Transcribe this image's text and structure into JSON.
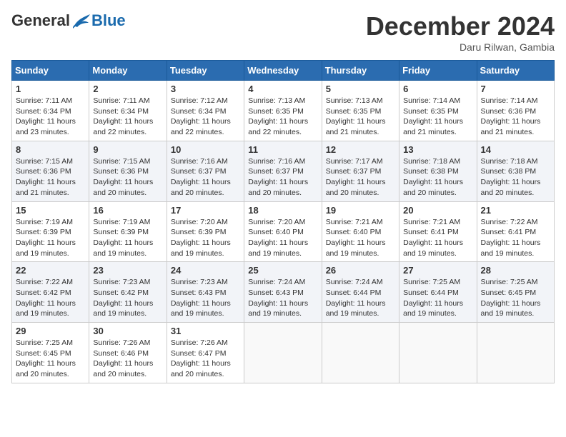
{
  "logo": {
    "general": "General",
    "blue": "Blue"
  },
  "title": "December 2024",
  "location": "Daru Rilwan, Gambia",
  "days_of_week": [
    "Sunday",
    "Monday",
    "Tuesday",
    "Wednesday",
    "Thursday",
    "Friday",
    "Saturday"
  ],
  "weeks": [
    [
      {
        "day": "1",
        "sunrise": "7:11 AM",
        "sunset": "6:34 PM",
        "daylight": "11 hours and 23 minutes."
      },
      {
        "day": "2",
        "sunrise": "7:11 AM",
        "sunset": "6:34 PM",
        "daylight": "11 hours and 22 minutes."
      },
      {
        "day": "3",
        "sunrise": "7:12 AM",
        "sunset": "6:34 PM",
        "daylight": "11 hours and 22 minutes."
      },
      {
        "day": "4",
        "sunrise": "7:13 AM",
        "sunset": "6:35 PM",
        "daylight": "11 hours and 22 minutes."
      },
      {
        "day": "5",
        "sunrise": "7:13 AM",
        "sunset": "6:35 PM",
        "daylight": "11 hours and 21 minutes."
      },
      {
        "day": "6",
        "sunrise": "7:14 AM",
        "sunset": "6:35 PM",
        "daylight": "11 hours and 21 minutes."
      },
      {
        "day": "7",
        "sunrise": "7:14 AM",
        "sunset": "6:36 PM",
        "daylight": "11 hours and 21 minutes."
      }
    ],
    [
      {
        "day": "8",
        "sunrise": "7:15 AM",
        "sunset": "6:36 PM",
        "daylight": "11 hours and 21 minutes."
      },
      {
        "day": "9",
        "sunrise": "7:15 AM",
        "sunset": "6:36 PM",
        "daylight": "11 hours and 20 minutes."
      },
      {
        "day": "10",
        "sunrise": "7:16 AM",
        "sunset": "6:37 PM",
        "daylight": "11 hours and 20 minutes."
      },
      {
        "day": "11",
        "sunrise": "7:16 AM",
        "sunset": "6:37 PM",
        "daylight": "11 hours and 20 minutes."
      },
      {
        "day": "12",
        "sunrise": "7:17 AM",
        "sunset": "6:37 PM",
        "daylight": "11 hours and 20 minutes."
      },
      {
        "day": "13",
        "sunrise": "7:18 AM",
        "sunset": "6:38 PM",
        "daylight": "11 hours and 20 minutes."
      },
      {
        "day": "14",
        "sunrise": "7:18 AM",
        "sunset": "6:38 PM",
        "daylight": "11 hours and 20 minutes."
      }
    ],
    [
      {
        "day": "15",
        "sunrise": "7:19 AM",
        "sunset": "6:39 PM",
        "daylight": "11 hours and 19 minutes."
      },
      {
        "day": "16",
        "sunrise": "7:19 AM",
        "sunset": "6:39 PM",
        "daylight": "11 hours and 19 minutes."
      },
      {
        "day": "17",
        "sunrise": "7:20 AM",
        "sunset": "6:39 PM",
        "daylight": "11 hours and 19 minutes."
      },
      {
        "day": "18",
        "sunrise": "7:20 AM",
        "sunset": "6:40 PM",
        "daylight": "11 hours and 19 minutes."
      },
      {
        "day": "19",
        "sunrise": "7:21 AM",
        "sunset": "6:40 PM",
        "daylight": "11 hours and 19 minutes."
      },
      {
        "day": "20",
        "sunrise": "7:21 AM",
        "sunset": "6:41 PM",
        "daylight": "11 hours and 19 minutes."
      },
      {
        "day": "21",
        "sunrise": "7:22 AM",
        "sunset": "6:41 PM",
        "daylight": "11 hours and 19 minutes."
      }
    ],
    [
      {
        "day": "22",
        "sunrise": "7:22 AM",
        "sunset": "6:42 PM",
        "daylight": "11 hours and 19 minutes."
      },
      {
        "day": "23",
        "sunrise": "7:23 AM",
        "sunset": "6:42 PM",
        "daylight": "11 hours and 19 minutes."
      },
      {
        "day": "24",
        "sunrise": "7:23 AM",
        "sunset": "6:43 PM",
        "daylight": "11 hours and 19 minutes."
      },
      {
        "day": "25",
        "sunrise": "7:24 AM",
        "sunset": "6:43 PM",
        "daylight": "11 hours and 19 minutes."
      },
      {
        "day": "26",
        "sunrise": "7:24 AM",
        "sunset": "6:44 PM",
        "daylight": "11 hours and 19 minutes."
      },
      {
        "day": "27",
        "sunrise": "7:25 AM",
        "sunset": "6:44 PM",
        "daylight": "11 hours and 19 minutes."
      },
      {
        "day": "28",
        "sunrise": "7:25 AM",
        "sunset": "6:45 PM",
        "daylight": "11 hours and 19 minutes."
      }
    ],
    [
      {
        "day": "29",
        "sunrise": "7:25 AM",
        "sunset": "6:45 PM",
        "daylight": "11 hours and 20 minutes."
      },
      {
        "day": "30",
        "sunrise": "7:26 AM",
        "sunset": "6:46 PM",
        "daylight": "11 hours and 20 minutes."
      },
      {
        "day": "31",
        "sunrise": "7:26 AM",
        "sunset": "6:47 PM",
        "daylight": "11 hours and 20 minutes."
      },
      null,
      null,
      null,
      null
    ]
  ]
}
